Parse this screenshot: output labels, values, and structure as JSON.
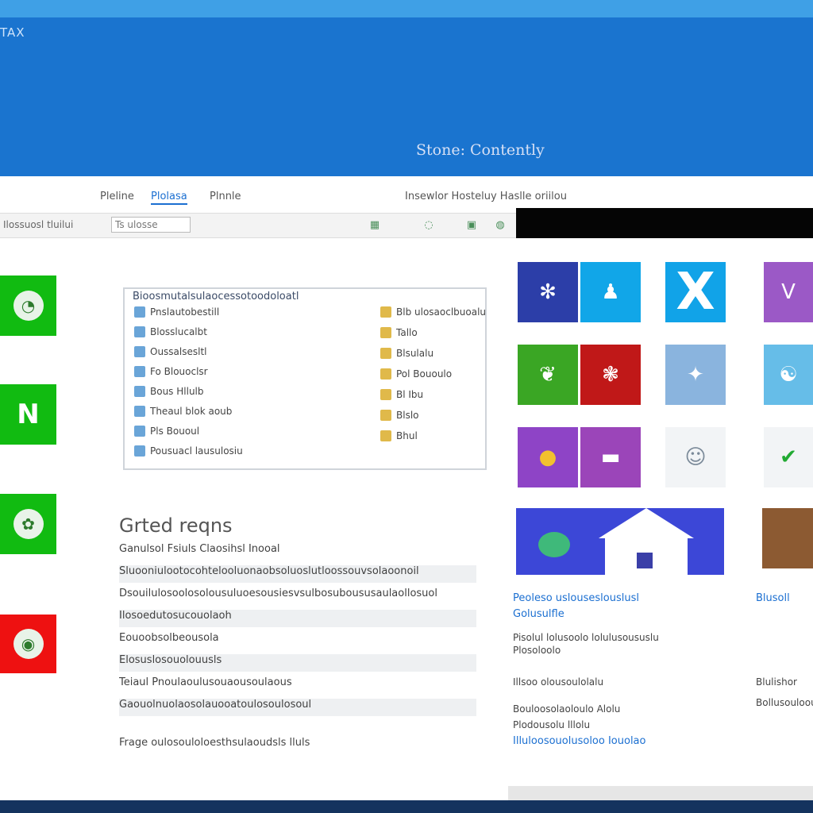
{
  "banner": {
    "title": "TAX",
    "caption": "Stone: Contently"
  },
  "nav": {
    "tab1": "Pleline",
    "tab2": "Plolasa",
    "tab3": "Plnnle",
    "tab4": "Insewlor Hosteluy Haslle oriilou"
  },
  "toolbar": {
    "label": "Ilossuosl tluilui",
    "input_value": "Ts ulosse",
    "icons": [
      "grid-icon",
      "info-icon",
      "bookmark-icon",
      "globe-icon"
    ]
  },
  "left_tiles": [
    {
      "glyph": "◔",
      "color": "#11bb11",
      "icon": "leaf-icon"
    },
    {
      "glyph": "N",
      "color": "#11bb11",
      "icon": "n-logo-icon"
    },
    {
      "glyph": "✿",
      "color": "#11bb11",
      "icon": "flower-icon"
    },
    {
      "glyph": "◉",
      "color": "#ee1111",
      "icon": "badge-icon"
    }
  ],
  "panel": {
    "title": "Bioosmutalsulaocessotoodoloatl",
    "left_items": [
      "Pnslautobestill",
      "Blosslucalbt",
      "Oussalsesltl",
      "Fo Blouoclsr",
      "Bous Hllulb",
      "Theaul blok aoub",
      "Pls Bououl",
      "Pousuacl lausulosiu"
    ],
    "right_items": [
      "Blb ulosaoclbuoalu",
      "Tallo",
      "Blsulalu",
      "Pol Bououlo",
      "Bl Ibu",
      "Blslo",
      "Bhul"
    ]
  },
  "section": {
    "title": "Grted reqns",
    "lines": [
      "Ganulsol Fsiuls Claosihsl Inooal",
      "Sluooniulootocohtelooluonaobsoluoslutloossouvsolaoonoil",
      "Dsouilulosoolosolousuluoesousiesvsulbosuboususaulaollosuol",
      "Ilosoedutosucouolaoh",
      "Eouoobsolbeousola",
      "Elosuslosouolouusls",
      "Teiaul Pnoulaoulusouaousoulaous",
      "Gaouolnuolaosolauooatoulosoulosoul"
    ],
    "footer": "Frage oulosouloloesthsulaoudsls lluls"
  },
  "tiles": [
    {
      "glyph": "✻",
      "color": "#2c3ea8",
      "icon": "coral-icon"
    },
    {
      "glyph": "♟",
      "color": "#11a6e8",
      "icon": "figure-icon"
    },
    {
      "glyph": "X",
      "color": "#11a3e8",
      "icon": "x-logo-icon"
    },
    {
      "glyph": "V",
      "color": "#9b59c6",
      "icon": "v-logo-icon"
    },
    {
      "glyph": "❦",
      "color": "#3aa624",
      "icon": "plant-icon"
    },
    {
      "glyph": "❃",
      "color": "#c01818",
      "icon": "snowflake-icon"
    },
    {
      "glyph": "✦",
      "color": "#8ab4de",
      "icon": "runner-icon"
    },
    {
      "glyph": "☯",
      "color": "#66bde8",
      "icon": "orb-icon"
    },
    {
      "glyph": "●",
      "color": "#8e44c6",
      "icon": "sun-icon"
    },
    {
      "glyph": "▬",
      "color": "#9b45b9",
      "icon": "dish-icon"
    },
    {
      "glyph": "☺",
      "color": "#f2f4f6",
      "icon": "face-icon"
    },
    {
      "glyph": "✔",
      "color": "#f2f4f6",
      "icon": "check-icon"
    }
  ],
  "right": {
    "link1": "Peoleso uslouseslouslusl",
    "link2": "Golusulfle",
    "text1": "Pisolul lolusoolo lolulusoususlu",
    "text2": "Plosoloolo",
    "text3": "Illsoo olousoulolalu",
    "text4": "Bouloosolaoloulo Alolu",
    "text5": "Plodousolu lllolu",
    "link3": "Illuloosouolusoloo Iouolao",
    "link4": "Blusoll",
    "text6": "Blulishor",
    "text7": "Bollusouloou"
  }
}
